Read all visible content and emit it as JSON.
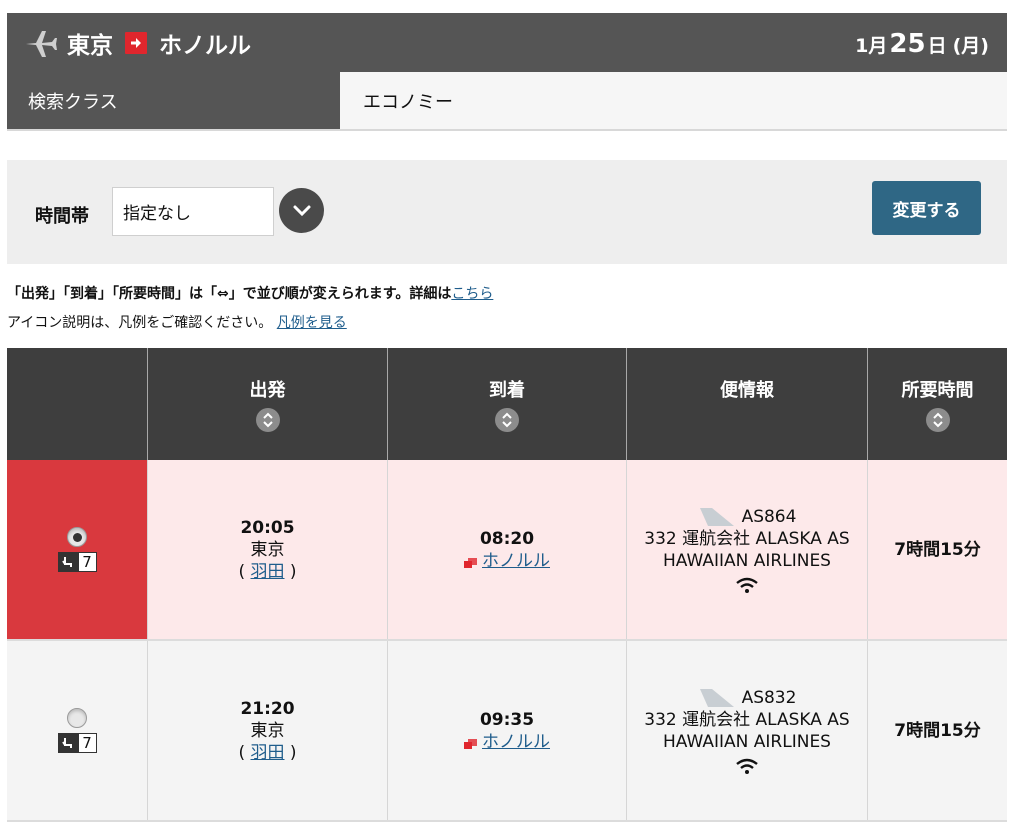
{
  "route": {
    "origin": "東京",
    "destination": "ホノルル",
    "date": {
      "month": "1",
      "month_unit": "月",
      "day": "25",
      "day_unit": "日",
      "dow": "(月)"
    }
  },
  "search_class": {
    "label": "検索クラス",
    "value": "エコノミー"
  },
  "filter": {
    "label": "時間帯",
    "selected": "指定なし",
    "button": "変更する"
  },
  "notes": {
    "line1": "「出発」「到着」「所要時間」は「⇔」で並び順が変えられます。詳細は",
    "line1_link": "こちら",
    "line2": "アイコン説明は、凡例をご確認ください。",
    "line2_link": "凡例を見る"
  },
  "table": {
    "headers": [
      "出発",
      "到着",
      "便情報",
      "所要時間"
    ],
    "rows": [
      {
        "selected": true,
        "seat_count": "7",
        "dep_time": "20:05",
        "dep_city": "東京",
        "dep_airport": "羽田",
        "arr_time": "08:20",
        "arr_city": "ホノルル",
        "flight_no": "AS864",
        "flight_line2": "332 運航会社 ALASKA AS",
        "flight_line3": "HAWAIIAN AIRLINES",
        "duration": "7時間15分"
      },
      {
        "selected": false,
        "seat_count": "7",
        "dep_time": "21:20",
        "dep_city": "東京",
        "dep_airport": "羽田",
        "arr_time": "09:35",
        "arr_city": "ホノルル",
        "flight_no": "AS832",
        "flight_line2": "332 運航会社 ALASKA AS",
        "flight_line3": "HAWAIIAN AIRLINES",
        "duration": "7時間15分"
      }
    ]
  },
  "colors": {
    "header_bg": "#555555",
    "accent_red": "#d9393e",
    "button_blue": "#2f6785",
    "link": "#1f5d8c",
    "selected_row": "#fde9ea"
  }
}
